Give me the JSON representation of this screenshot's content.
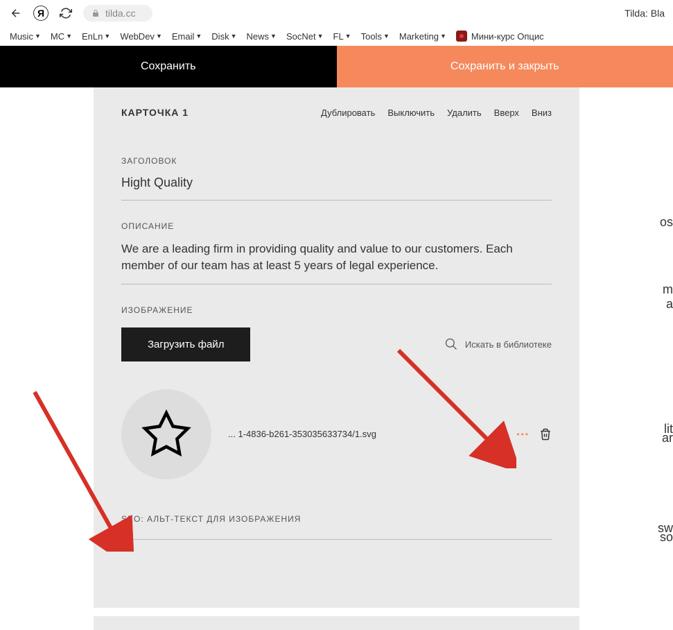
{
  "browser": {
    "url": "tilda.cc",
    "tab_title": "Tilda: Bla"
  },
  "bookmarks": [
    {
      "label": "Music"
    },
    {
      "label": "MC"
    },
    {
      "label": "EnLn"
    },
    {
      "label": "WebDev"
    },
    {
      "label": "Email"
    },
    {
      "label": "Disk"
    },
    {
      "label": "News"
    },
    {
      "label": "SocNet"
    },
    {
      "label": "FL"
    },
    {
      "label": "Tools"
    },
    {
      "label": "Marketing"
    }
  ],
  "bookmark_course": "Мини-курс Опцис",
  "actions": {
    "save": "Сохранить",
    "save_close": "Сохранить и закрыть"
  },
  "card": {
    "title": "КАРТОЧКА 1",
    "header_actions": {
      "duplicate": "Дублировать",
      "toggle": "Выключить",
      "delete": "Удалить",
      "up": "Вверх",
      "down": "Вниз"
    },
    "heading_label": "ЗАГОЛОВОК",
    "heading_value": "Hight Quality",
    "description_label": "ОПИСАНИЕ",
    "description_value": "We are a leading firm in providing quality and value to our customers. Each member of our team has at least 5 years of legal experience.",
    "image_label": "ИЗОБРАЖЕНИЕ",
    "upload_button": "Загрузить файл",
    "library_search": "Искать в библиотеке",
    "filename": "... 1-4836-b261-353035633734/1.svg",
    "alt_label": "SEO: АЛЬТ-ТЕКСТ ДЛЯ ИЗОБРАЖЕНИЯ"
  },
  "right_partials": {
    "p1": "os",
    "p2": "m",
    "p3": "a",
    "p4": "lit",
    "p5": "ar",
    "p6": "sw",
    "p7": "so"
  }
}
